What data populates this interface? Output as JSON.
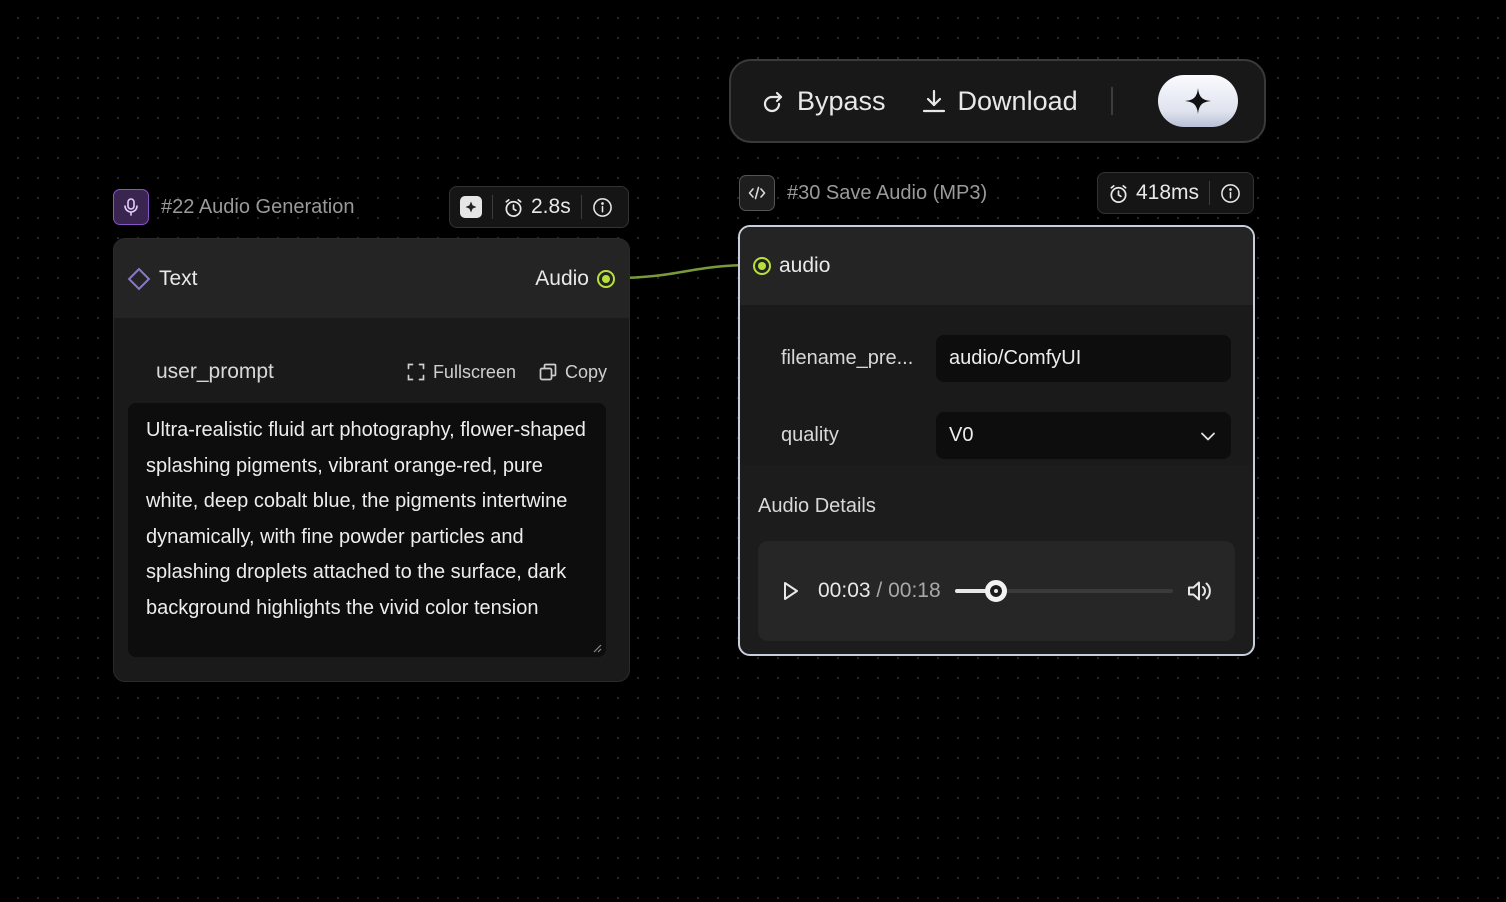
{
  "toolbar": {
    "bypass_label": "Bypass",
    "download_label": "Download",
    "ai_icon": "sparkle-icon"
  },
  "nodes": [
    {
      "id": "22",
      "title": "#22 Audio Generation",
      "icon": "microphone-icon",
      "status": {
        "duration": "2.8s"
      },
      "input_label": "Text",
      "output_label": "Audio",
      "widget": {
        "name": "user_prompt",
        "fullscreen_label": "Fullscreen",
        "copy_label": "Copy",
        "value": "Ultra-realistic fluid art photography, flower-shaped splashing pigments, vibrant orange-red, pure white, deep cobalt blue, the pigments intertwine dynamically, with fine powder particles and splashing droplets attached to the surface, dark background highlights the vivid color tension"
      }
    },
    {
      "id": "30",
      "title": "#30 Save Audio (MP3)",
      "icon": "code-icon",
      "status": {
        "duration": "418ms"
      },
      "input_label": "audio",
      "widgets": {
        "filename_label": "filename_pre...",
        "filename_value": "audio/ComfyUI",
        "quality_label": "quality",
        "quality_value": "V0"
      },
      "details_title": "Audio Details",
      "player": {
        "current": "00:03",
        "separator": "/",
        "total": "00:18",
        "progress_fraction": 0.19
      }
    }
  ],
  "colors": {
    "port": "#b8e03a",
    "wire": "#7a9a3a",
    "selected_border": "#c8cfdc"
  }
}
